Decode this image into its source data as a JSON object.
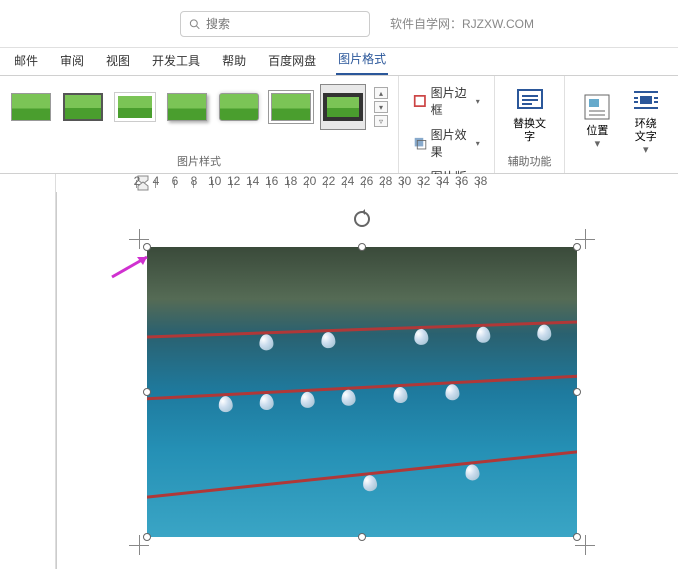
{
  "titlebar": {
    "search_placeholder": "搜索",
    "watermark": "软件自学网：RJZXW.COM"
  },
  "tabs": {
    "items": [
      "邮件",
      "审阅",
      "视图",
      "开发工具",
      "帮助",
      "百度网盘",
      "图片格式"
    ],
    "active_index": 6
  },
  "ribbon": {
    "styles_label": "图片样式",
    "border_label": "图片边框",
    "effects_label": "图片效果",
    "layout_label": "图片版式",
    "alt_text": "替换文字",
    "accessibility_label": "辅助功能",
    "position": "位置",
    "wrap": "环绕文字"
  },
  "ruler": {
    "marks": [
      "2",
      "4",
      "6",
      "8",
      "10",
      "12",
      "14",
      "16",
      "18",
      "20",
      "22",
      "24",
      "26",
      "28",
      "30",
      "32",
      "34",
      "36",
      "38"
    ]
  }
}
